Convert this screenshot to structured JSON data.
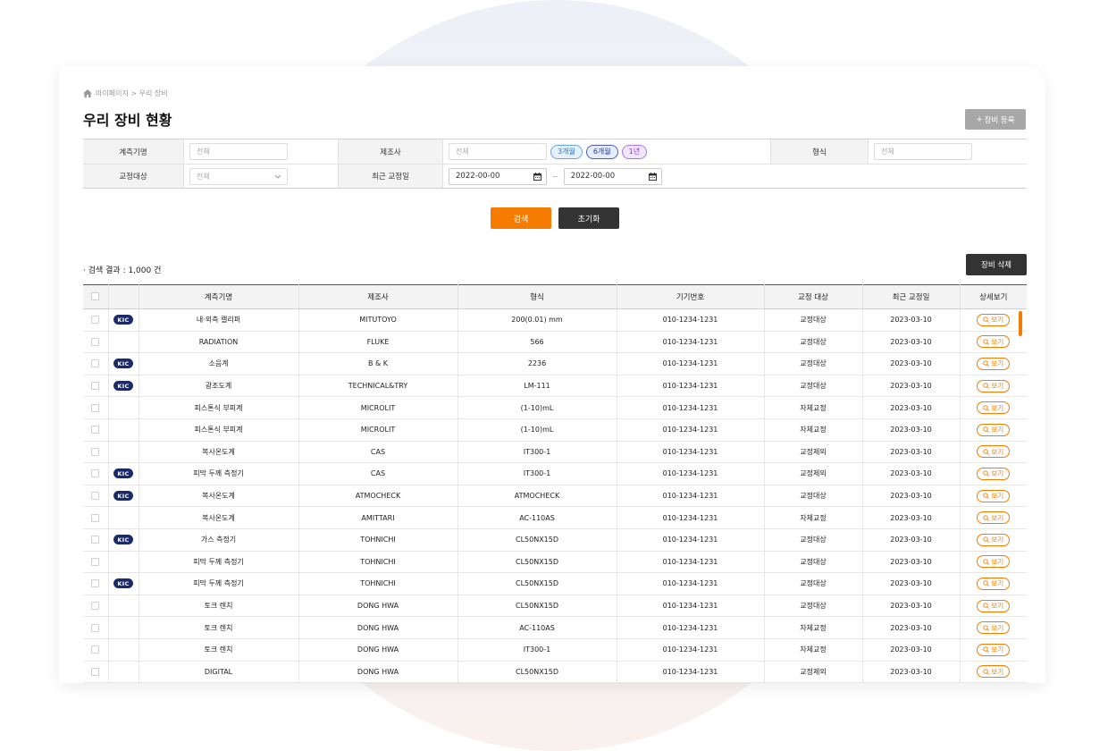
{
  "breadcrumb": {
    "path": "마이페이지 > 우리 장비"
  },
  "page_title": "우리 장비 현황",
  "register_button": "장비 등록",
  "filters": {
    "measure_name": {
      "label": "계측기명",
      "placeholder": "전체"
    },
    "manufacturer": {
      "label": "제조사",
      "placeholder": "전체",
      "quick": [
        "3개월",
        "6개월",
        "1년"
      ]
    },
    "model": {
      "label": "형식",
      "placeholder": "전체"
    },
    "calibration_target": {
      "label": "교정대상",
      "value": "전체"
    },
    "recent_calibration": {
      "label": "최근 교정일",
      "from": "2022-00-00",
      "to": "2022-00-00",
      "separator": "~"
    }
  },
  "search_button": "검색",
  "reset_button": "초기화",
  "result_count": "· 검색 결과 : 1,000 건",
  "delete_button": "장비 삭제",
  "table": {
    "headers": [
      "계측기명",
      "제조사",
      "형식",
      "기기번호",
      "교정 대상",
      "최근 교정일",
      "상세보기"
    ],
    "badge_text": "KIC",
    "view_label": "보기",
    "rows": [
      {
        "kic": true,
        "name": "내·외측 캘리퍼",
        "maker": "MITUTOYO",
        "model": "200(0.01) mm",
        "serial": "010-1234-1231",
        "target": "교정대상",
        "date": "2023-03-10"
      },
      {
        "kic": false,
        "name": "RADIATION",
        "maker": "FLUKE",
        "model": "566",
        "serial": "010-1234-1231",
        "target": "교정대상",
        "date": "2023-03-10"
      },
      {
        "kic": true,
        "name": "소음계",
        "maker": "B & K",
        "model": "2236",
        "serial": "010-1234-1231",
        "target": "교정대상",
        "date": "2023-03-10"
      },
      {
        "kic": true,
        "name": "광조도계",
        "maker": "TECHNICAL&TRY",
        "model": "LM-111",
        "serial": "010-1234-1231",
        "target": "교정대상",
        "date": "2023-03-10"
      },
      {
        "kic": false,
        "name": "피스톤식 부피계",
        "maker": "MICROLIT",
        "model": "(1-10)mL",
        "serial": "010-1234-1231",
        "target": "자체교정",
        "date": "2023-03-10"
      },
      {
        "kic": false,
        "name": "피스톤식 부피계",
        "maker": "MICROLIT",
        "model": "(1-10)mL",
        "serial": "010-1234-1231",
        "target": "자체교정",
        "date": "2023-03-10"
      },
      {
        "kic": false,
        "name": "복사온도계",
        "maker": "CAS",
        "model": "IT300-1",
        "serial": "010-1234-1231",
        "target": "교정제외",
        "date": "2023-03-10"
      },
      {
        "kic": true,
        "name": "피막 두께 측정기",
        "maker": "CAS",
        "model": "IT300-1",
        "serial": "010-1234-1231",
        "target": "교정제외",
        "date": "2023-03-10"
      },
      {
        "kic": true,
        "name": "복사온도계",
        "maker": "ATMOCHECK",
        "model": "ATMOCHECK",
        "serial": "010-1234-1231",
        "target": "교정대상",
        "date": "2023-03-10"
      },
      {
        "kic": false,
        "name": "복사온도계",
        "maker": "AMITTARI",
        "model": "AC-110AS",
        "serial": "010-1234-1231",
        "target": "자체교정",
        "date": "2023-03-10"
      },
      {
        "kic": true,
        "name": "가스 측정기",
        "maker": "TOHNICHI",
        "model": "CL50NX15D",
        "serial": "010-1234-1231",
        "target": "교정대상",
        "date": "2023-03-10"
      },
      {
        "kic": false,
        "name": "피막 두께 측정기",
        "maker": "TOHNICHI",
        "model": "CL50NX15D",
        "serial": "010-1234-1231",
        "target": "교정대상",
        "date": "2023-03-10"
      },
      {
        "kic": true,
        "name": "피막 두께 측정기",
        "maker": "TOHNICHI",
        "model": "CL50NX15D",
        "serial": "010-1234-1231",
        "target": "교정대상",
        "date": "2023-03-10"
      },
      {
        "kic": false,
        "name": "토크 렌치",
        "maker": "DONG HWA",
        "model": "CL50NX15D",
        "serial": "010-1234-1231",
        "target": "교정대상",
        "date": "2023-03-10"
      },
      {
        "kic": false,
        "name": "토크 렌치",
        "maker": "DONG HWA",
        "model": "AC-110AS",
        "serial": "010-1234-1231",
        "target": "자체교정",
        "date": "2023-03-10"
      },
      {
        "kic": false,
        "name": "토크 렌치",
        "maker": "DONG HWA",
        "model": "IT300-1",
        "serial": "010-1234-1231",
        "target": "자체교정",
        "date": "2023-03-10"
      },
      {
        "kic": false,
        "name": "DIGITAL",
        "maker": "DONG HWA",
        "model": "CL50NX15D",
        "serial": "010-1234-1231",
        "target": "교정제외",
        "date": "2023-03-10"
      }
    ]
  }
}
